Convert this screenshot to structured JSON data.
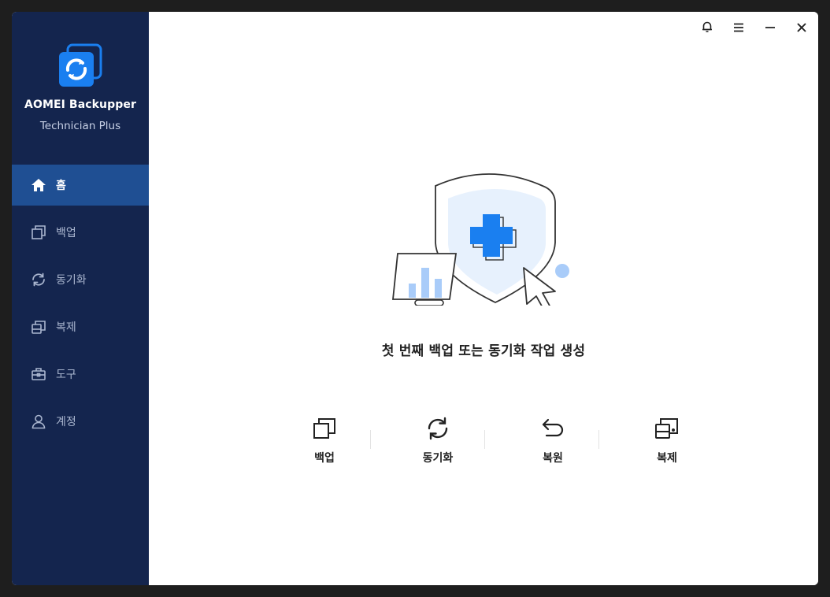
{
  "app": {
    "name": "AOMEI Backupper",
    "edition": "Technician Plus"
  },
  "sidebar": {
    "items": [
      {
        "label": "홈",
        "icon": "home-icon",
        "active": true
      },
      {
        "label": "백업",
        "icon": "backup-icon",
        "active": false
      },
      {
        "label": "동기화",
        "icon": "sync-icon",
        "active": false
      },
      {
        "label": "복제",
        "icon": "clone-icon",
        "active": false
      },
      {
        "label": "도구",
        "icon": "toolbox-icon",
        "active": false
      },
      {
        "label": "계정",
        "icon": "account-icon",
        "active": false
      }
    ]
  },
  "titlebar": {
    "buttons": [
      "bell-icon",
      "menu-icon",
      "minimize-icon",
      "close-icon"
    ]
  },
  "main": {
    "headline": "첫 번째 백업 또는 동기화 작업 생성",
    "quick_actions": [
      {
        "label": "백업",
        "icon": "backup-icon"
      },
      {
        "label": "동기화",
        "icon": "sync-icon"
      },
      {
        "label": "복원",
        "icon": "restore-icon"
      },
      {
        "label": "복제",
        "icon": "clone-icon"
      }
    ]
  },
  "colors": {
    "sidebar_bg": "#14254e",
    "sidebar_active": "#1f4f93",
    "accent_blue": "#1a7ff0",
    "light_blue": "#a9ccf9"
  }
}
